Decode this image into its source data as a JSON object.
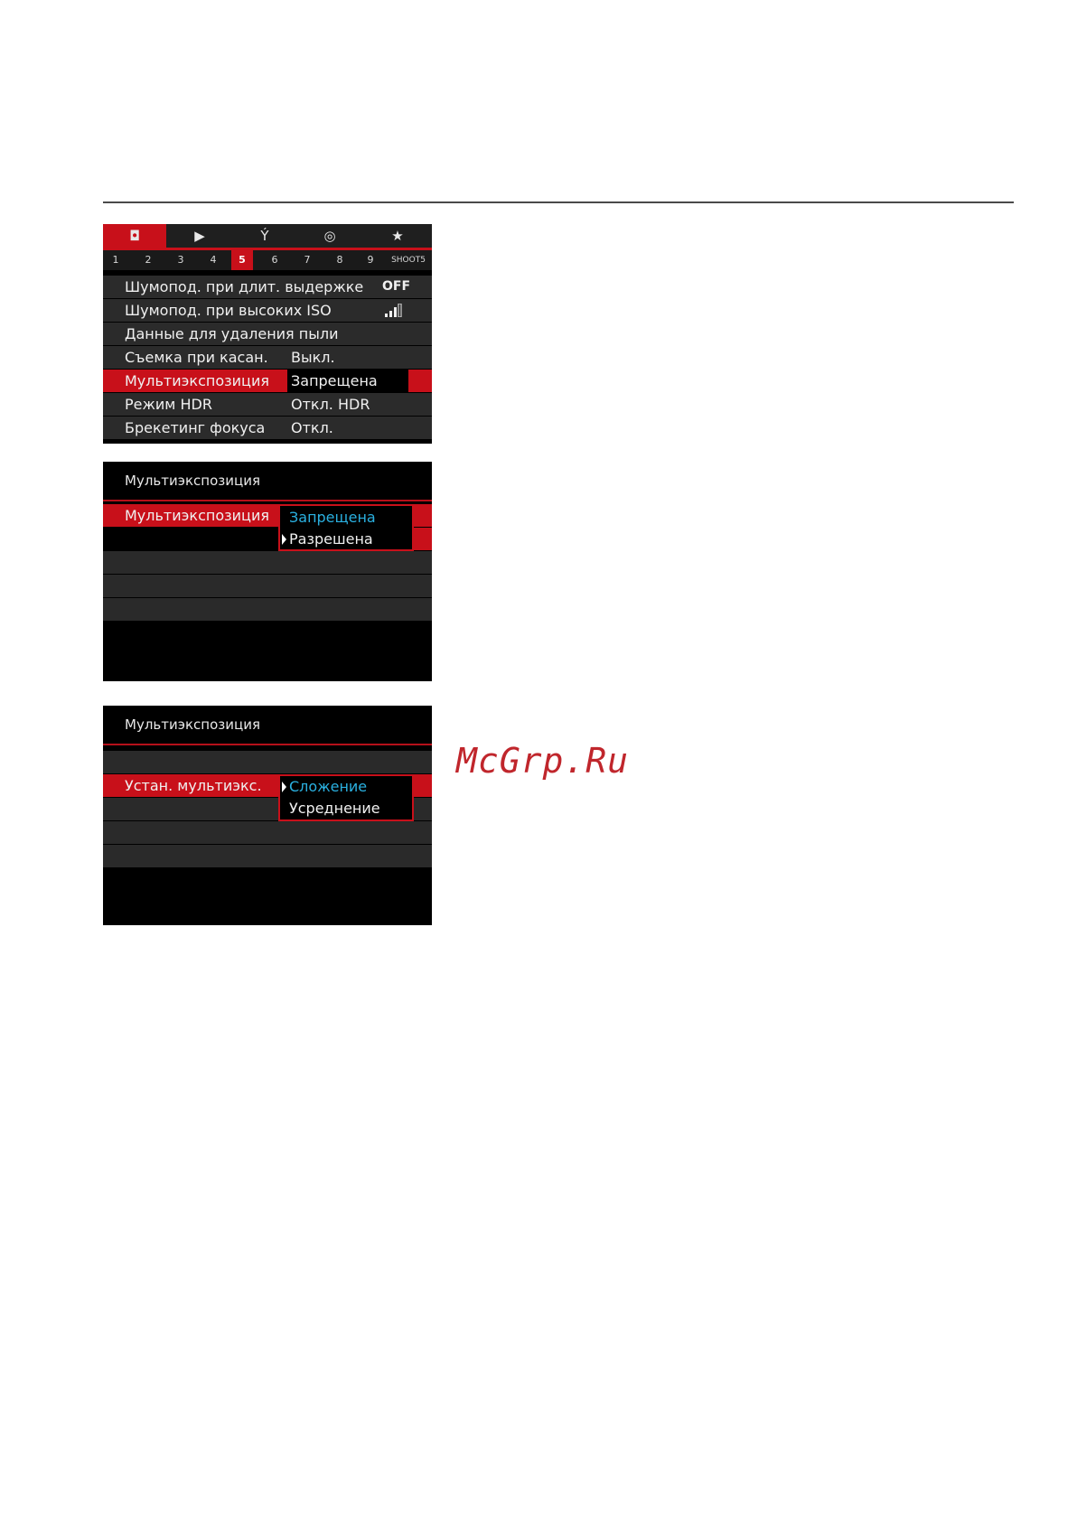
{
  "screen1": {
    "tabs": [
      {
        "icon": "camera-icon",
        "glyph": "◘"
      },
      {
        "icon": "playback-icon",
        "glyph": "▶"
      },
      {
        "icon": "wrench-icon",
        "glyph": "Ý"
      },
      {
        "icon": "custom-icon",
        "glyph": "◎"
      },
      {
        "icon": "star-icon",
        "glyph": "★"
      }
    ],
    "numbers": [
      "1",
      "2",
      "3",
      "4",
      "5",
      "6",
      "7",
      "8",
      "9",
      "SHOOT5"
    ],
    "active_number": "5",
    "items": [
      {
        "label": "Шумопод. при длит. выдержке",
        "value": "OFF"
      },
      {
        "label": "Шумопод. при высоких ISO",
        "value": ""
      },
      {
        "label": "Данные для удаления пыли",
        "value": ""
      },
      {
        "label": "Съемка при касан.",
        "value": "Выкл."
      },
      {
        "label": "Мультиэкспозиция",
        "value": "Запрещена"
      },
      {
        "label": "Режим HDR",
        "value": "Откл. HDR"
      },
      {
        "label": "Брекетинг фокуса",
        "value": "Откл."
      }
    ]
  },
  "screen2": {
    "title": "Мультиэкспозиция",
    "row_label": "Мультиэкспозиция",
    "options": [
      "Запрещена",
      "Разрешена"
    ]
  },
  "screen3": {
    "title": "Мультиэкспозиция",
    "row_label": "Устан. мультиэкс.",
    "options": [
      "Сложение",
      "Усреднение"
    ]
  },
  "watermark": "McGrp.Ru",
  "colors": {
    "accent": "#c8101a",
    "selected_option": "#2ab0e0"
  }
}
